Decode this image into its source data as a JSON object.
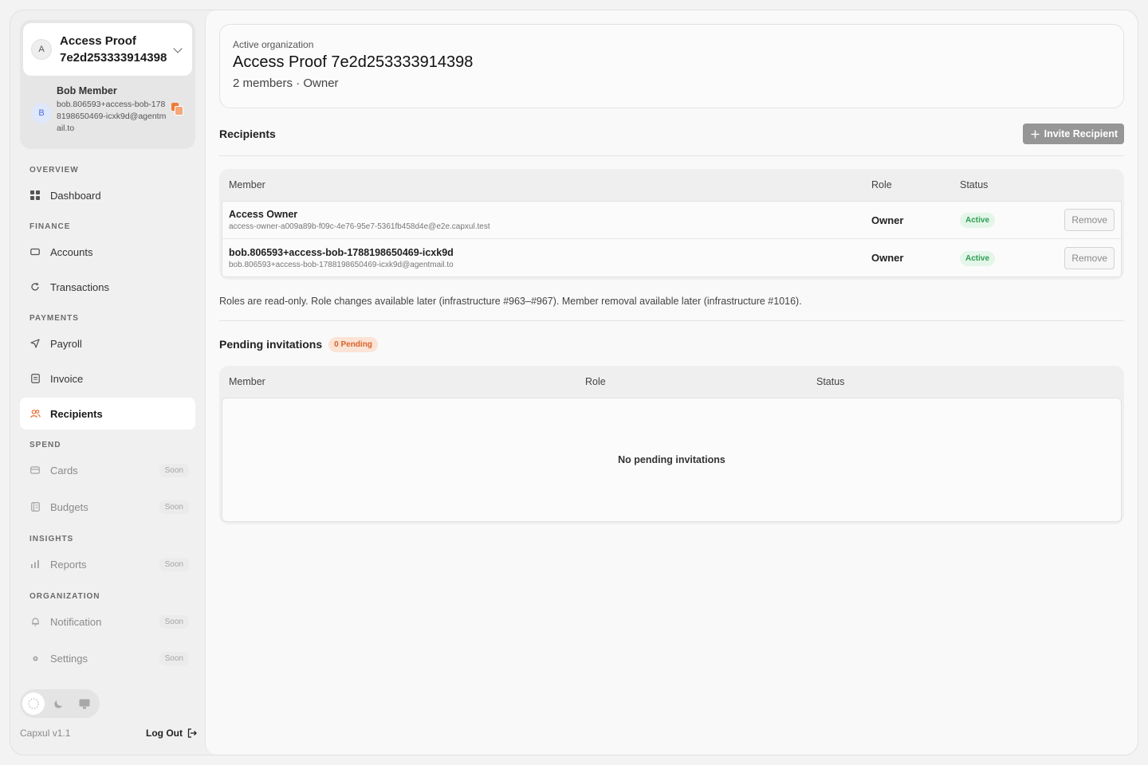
{
  "org": {
    "initial": "A",
    "name": "Access Proof 7e2d253333914398"
  },
  "user": {
    "initial": "B",
    "name": "Bob Member",
    "email": "bob.806593+access-bob-1788198650469-icxk9d@agentmail.to"
  },
  "sidebar": {
    "sections": {
      "overview": "OVERVIEW",
      "finance": "FINANCE",
      "payments": "PAYMENTS",
      "spend": "SPEND",
      "insights": "INSIGHTS",
      "organization": "ORGANIZATION"
    },
    "items": {
      "dashboard": "Dashboard",
      "accounts": "Accounts",
      "transactions": "Transactions",
      "payroll": "Payroll",
      "invoice": "Invoice",
      "recipients": "Recipients",
      "cards": "Cards",
      "budgets": "Budgets",
      "reports": "Reports",
      "notification": "Notification",
      "settings": "Settings"
    },
    "soon_label": "Soon",
    "active_item": "recipients"
  },
  "footer": {
    "version": "Capxul v1.1",
    "logout": "Log Out"
  },
  "header": {
    "label": "Active organization",
    "title": "Access Proof 7e2d253333914398",
    "subtitle": "2 members · Owner"
  },
  "recipients": {
    "title": "Recipients",
    "invite_button": "Invite Recipient",
    "columns": {
      "member": "Member",
      "role": "Role",
      "status": "Status"
    },
    "rows": [
      {
        "name": "Access Owner",
        "email": "access-owner-a009a89b-f09c-4e76-95e7-5361fb458d4e@e2e.capxul.test",
        "role": "Owner",
        "status": "Active",
        "action": "Remove"
      },
      {
        "name": "bob.806593+access-bob-1788198650469-icxk9d",
        "email": "bob.806593+access-bob-1788198650469-icxk9d@agentmail.to",
        "role": "Owner",
        "status": "Active",
        "action": "Remove"
      }
    ],
    "note": "Roles are read-only. Role changes available later (infrastructure #963–#967). Member removal available later (infrastructure #1016)."
  },
  "pending": {
    "title": "Pending invitations",
    "badge": "0 Pending",
    "columns": {
      "member": "Member",
      "role": "Role",
      "status": "Status"
    },
    "empty": "No pending invitations"
  },
  "colors": {
    "accent": "#e8692b",
    "active_green": "#2e9e52",
    "invite_button_bg": "#969696"
  }
}
